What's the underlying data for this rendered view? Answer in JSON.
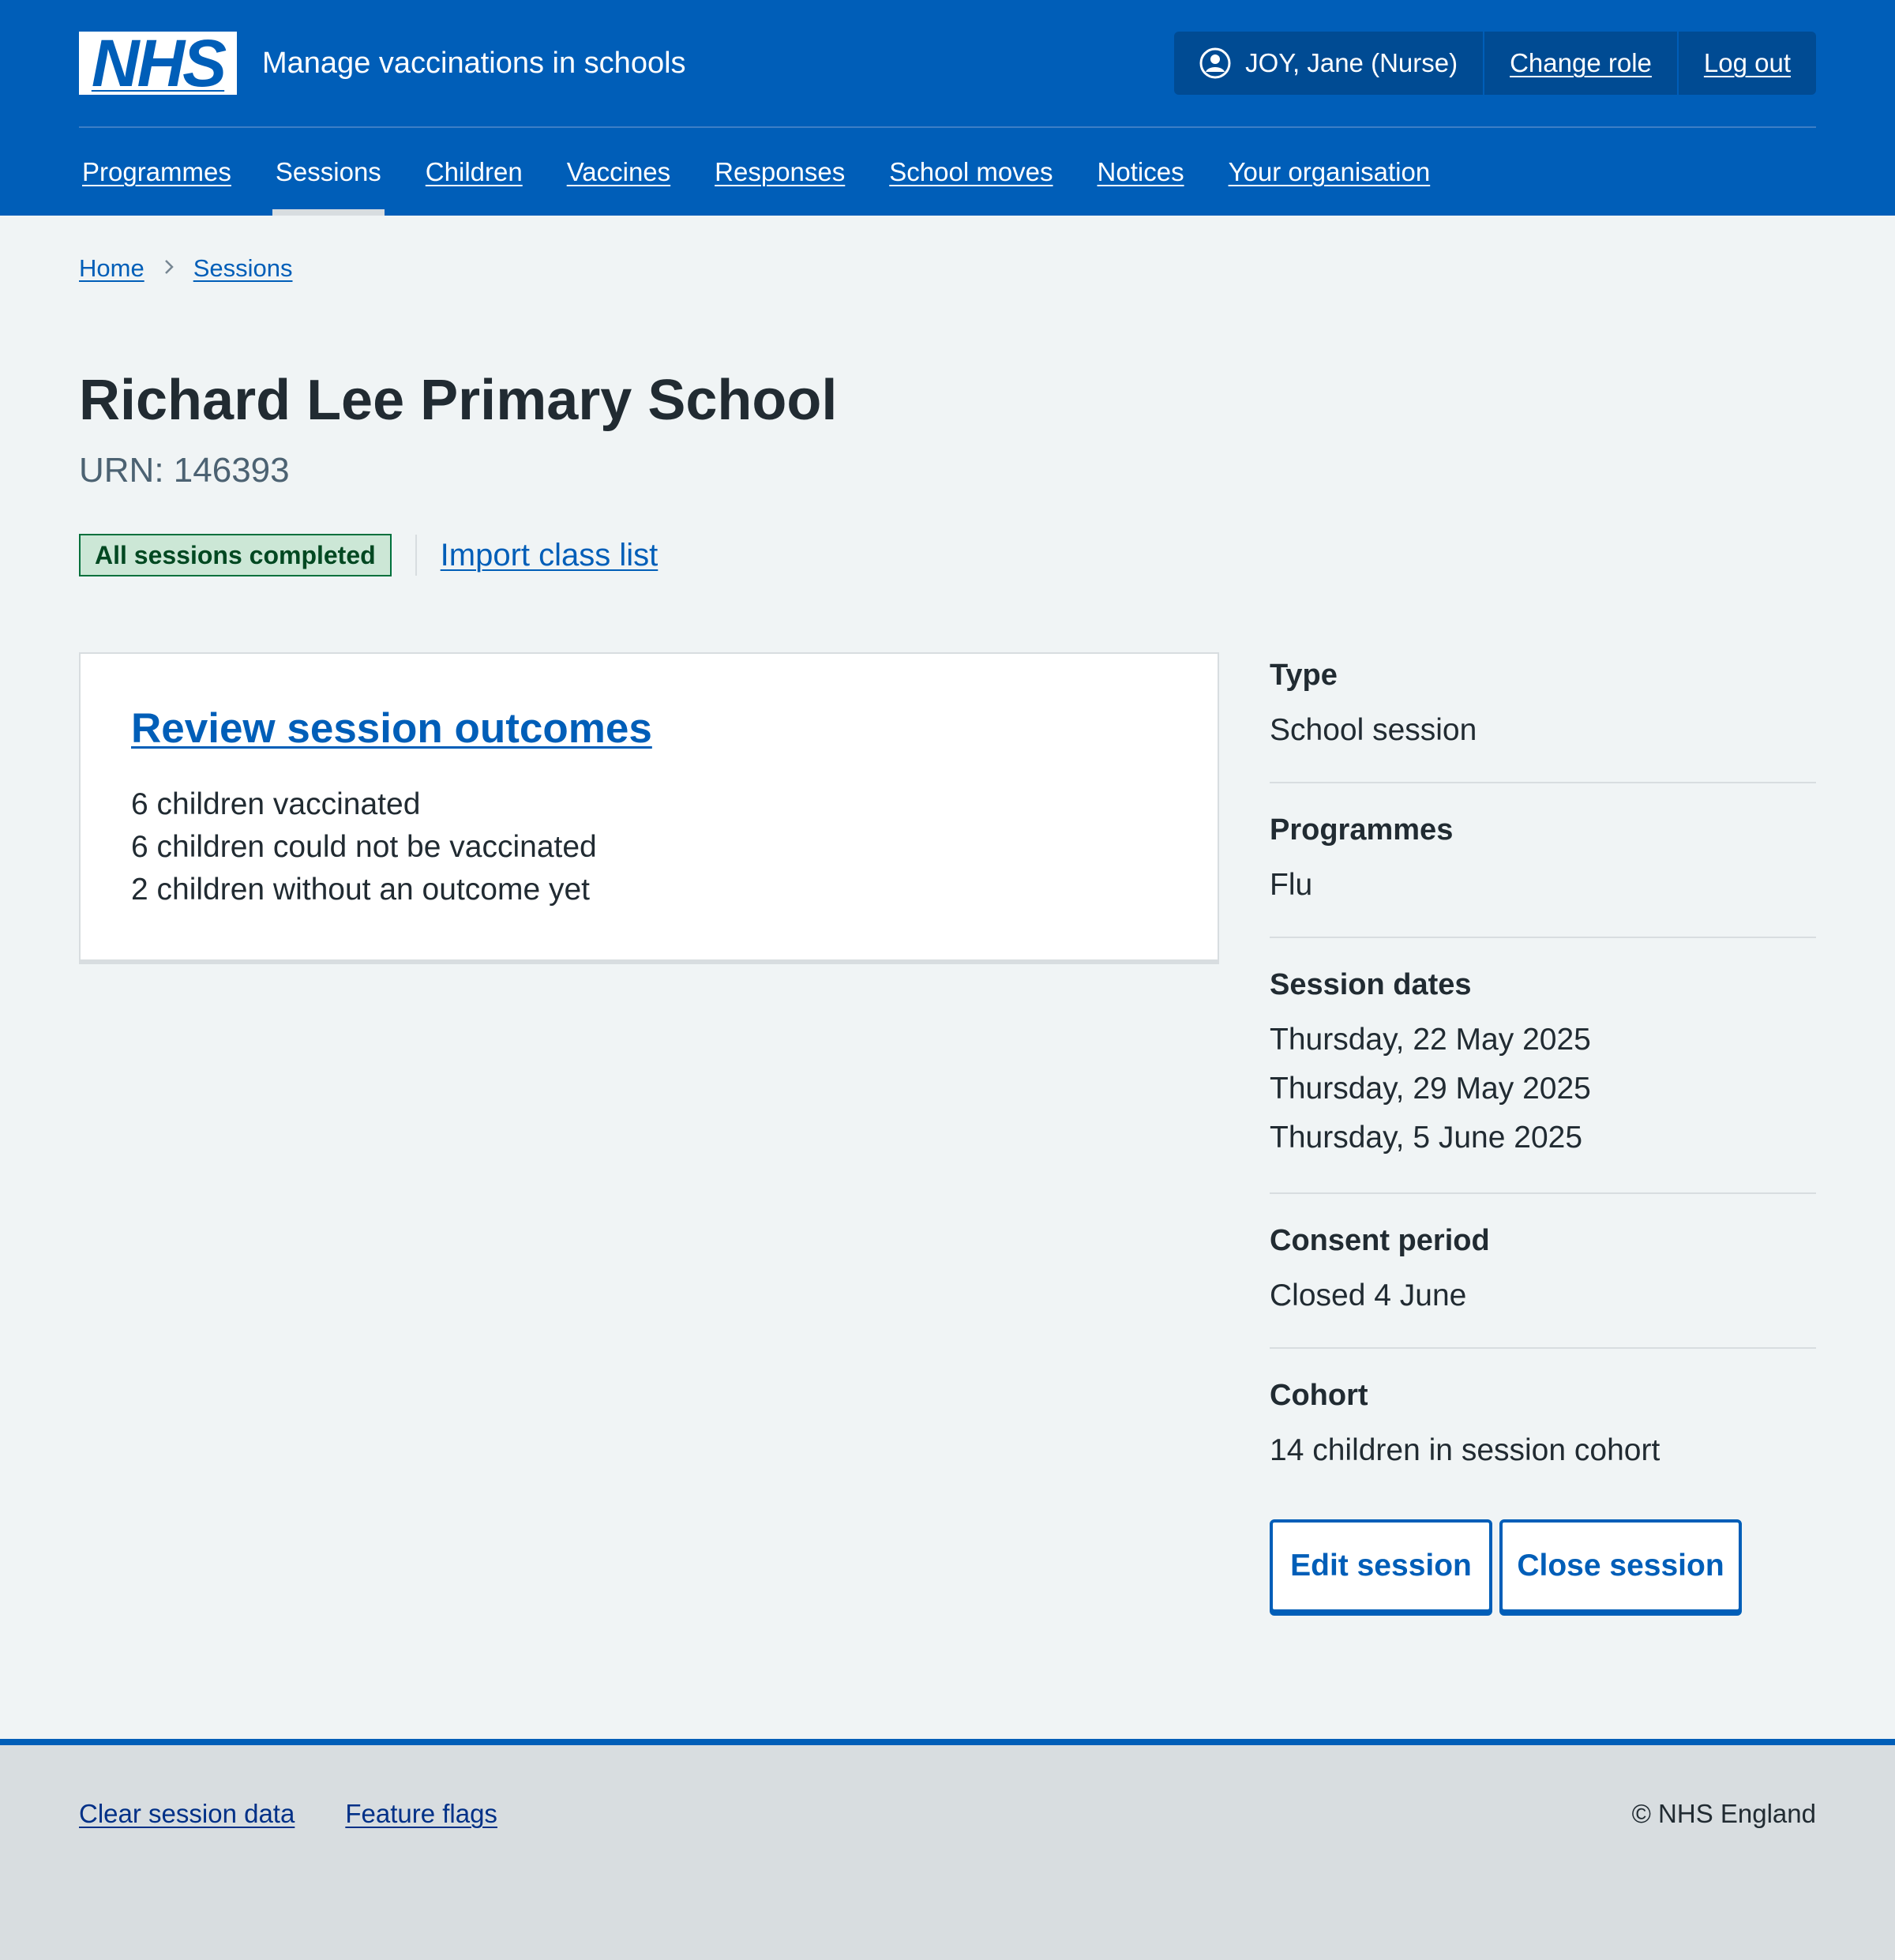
{
  "header": {
    "logo_text": "NHS",
    "service_name": "Manage vaccinations in schools",
    "user_name": "JOY, Jane (Nurse)",
    "change_role": "Change role",
    "log_out": "Log out"
  },
  "nav": {
    "items": [
      {
        "label": "Programmes",
        "current": false
      },
      {
        "label": "Sessions",
        "current": true
      },
      {
        "label": "Children",
        "current": false
      },
      {
        "label": "Vaccines",
        "current": false
      },
      {
        "label": "Responses",
        "current": false
      },
      {
        "label": "School moves",
        "current": false
      },
      {
        "label": "Notices",
        "current": false
      },
      {
        "label": "Your organisation",
        "current": false
      }
    ]
  },
  "breadcrumb": {
    "home": "Home",
    "sessions": "Sessions"
  },
  "page": {
    "title": "Richard Lee Primary School",
    "caption": "URN: 146393",
    "status_tag": "All sessions completed",
    "import_link": "Import class list"
  },
  "card": {
    "heading": "Review session outcomes",
    "lines": [
      "6 children vaccinated",
      "6 children could not be vaccinated",
      "2 children without an outcome yet"
    ]
  },
  "summary": {
    "rows": [
      {
        "key": "Type",
        "values": [
          "School session"
        ]
      },
      {
        "key": "Programmes",
        "values": [
          "Flu"
        ]
      },
      {
        "key": "Session dates",
        "values": [
          "Thursday, 22 May 2025",
          "Thursday, 29 May 2025",
          "Thursday, 5 June 2025"
        ]
      },
      {
        "key": "Consent period",
        "values": [
          "Closed 4 June"
        ]
      },
      {
        "key": "Cohort",
        "values": [
          "14 children in session cohort"
        ]
      }
    ]
  },
  "buttons": {
    "edit": "Edit session",
    "close": "Close session"
  },
  "footer": {
    "clear_session": "Clear session data",
    "feature_flags": "Feature flags",
    "copyright": "© NHS England"
  },
  "colors": {
    "nhs_blue": "#005eb8",
    "dark_blue": "#004b93",
    "success_green": "#00703c",
    "tag_bg": "#cce7d6",
    "page_bg": "#f0f4f5",
    "footer_bg": "#d8dde0"
  },
  "icons": {
    "user": "user-circle-icon",
    "breadcrumb_separator": "chevron-right-icon"
  }
}
